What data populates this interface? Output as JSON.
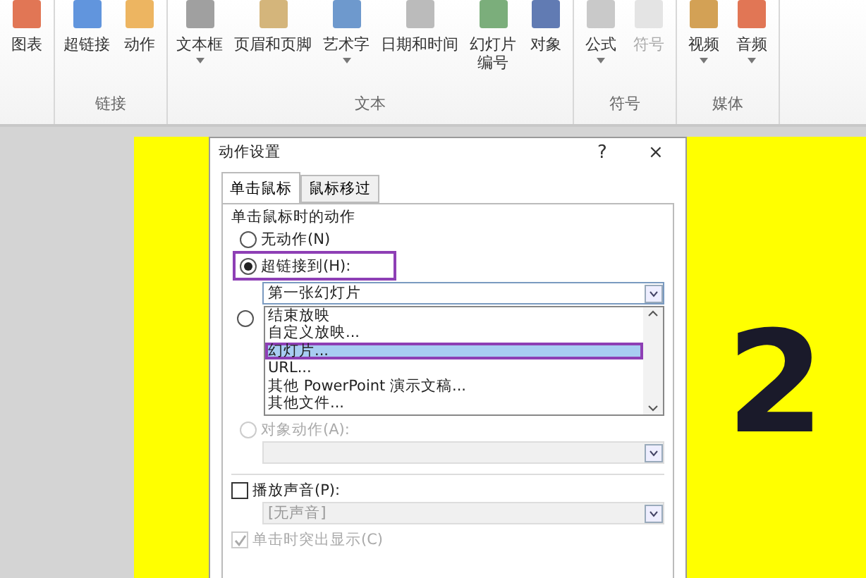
{
  "ribbon": {
    "groups": [
      {
        "items": [
          {
            "label": "图表",
            "dropdown": false,
            "disabled": false
          }
        ]
      },
      {
        "label": "链接",
        "items": [
          {
            "label": "超链接",
            "dropdown": false,
            "disabled": false
          },
          {
            "label": "动作",
            "dropdown": false,
            "disabled": false
          }
        ]
      },
      {
        "label": "文本",
        "items": [
          {
            "label": "文本框",
            "dropdown": true,
            "disabled": false
          },
          {
            "label": "页眉和页脚",
            "dropdown": false,
            "disabled": false
          },
          {
            "label": "艺术字",
            "dropdown": true,
            "disabled": false
          },
          {
            "label": "日期和时间",
            "dropdown": false,
            "disabled": false
          },
          {
            "label": "幻灯片",
            "label_2": "编号",
            "dropdown": false,
            "disabled": false
          },
          {
            "label": "对象",
            "dropdown": false,
            "disabled": false
          }
        ]
      },
      {
        "label": "符号",
        "items": [
          {
            "label": "公式",
            "dropdown": true,
            "disabled": false
          },
          {
            "label": "符号",
            "dropdown": false,
            "disabled": true
          }
        ]
      },
      {
        "label": "媒体",
        "items": [
          {
            "label": "视频",
            "dropdown": true,
            "disabled": false
          },
          {
            "label": "音频",
            "dropdown": true,
            "disabled": false
          }
        ]
      }
    ]
  },
  "slide": {
    "text": "2"
  },
  "dialog": {
    "title": "动作设置",
    "help": "?",
    "close": "×",
    "tabs": [
      {
        "label": "单击鼠标",
        "selected": true
      },
      {
        "label": "鼠标移过",
        "selected": false
      }
    ],
    "group_title": "单击鼠标时的动作",
    "no_action": {
      "label": "无动作(N)",
      "selected": false
    },
    "hyperlink": {
      "label": "超链接到(H):",
      "selected": true,
      "annotated": true,
      "value": "第一张幻灯片",
      "list": [
        {
          "label": "结束放映",
          "selected": false,
          "annotated": false
        },
        {
          "label": "自定义放映...",
          "selected": false,
          "annotated": false
        },
        {
          "label": "幻灯片...",
          "selected": true,
          "annotated": true
        },
        {
          "label": "URL...",
          "selected": false,
          "annotated": false
        },
        {
          "label": "其他 PowerPoint 演示文稿...",
          "selected": false,
          "annotated": false
        },
        {
          "label": "其他文件...",
          "selected": false,
          "annotated": false
        }
      ]
    },
    "run_program": {
      "selected": false
    },
    "object_action": {
      "label": "对象动作(A):",
      "selected": false,
      "disabled": true
    },
    "play_sound": {
      "label": "播放声音(P):",
      "checked": false,
      "value": "[无声音]"
    },
    "highlight": {
      "label": "单击时突出显示(C)",
      "checked": true,
      "disabled": true
    }
  }
}
